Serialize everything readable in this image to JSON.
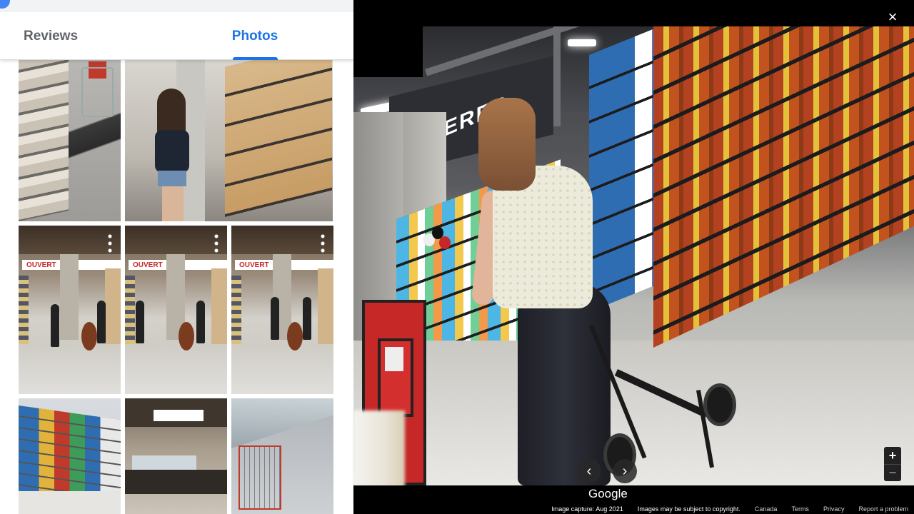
{
  "tabs": [
    {
      "label": "Reviews",
      "active": false
    },
    {
      "label": "Photos",
      "active": true
    }
  ],
  "viewer": {
    "close_icon": "×",
    "prev_icon": "‹",
    "next_icon": "›",
    "zoom_in": "+",
    "zoom_out": "−",
    "logo": "Google",
    "wall_sign": "BIERES",
    "thumb_sign": "OUVERT"
  },
  "footer": {
    "capture": "Image capture: Aug 2021",
    "copyright": "Images may be subject to copyright.",
    "links": [
      "Canada",
      "Terms",
      "Privacy",
      "Report a problem"
    ]
  },
  "colors": {
    "accent": "#1a73e8",
    "tab_inactive": "#5f6368"
  }
}
